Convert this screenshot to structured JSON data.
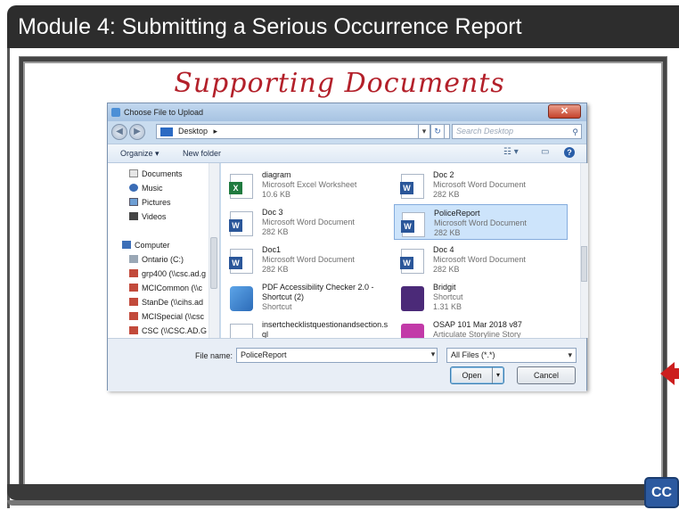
{
  "title_bar": {
    "text": "Module 4:  Submitting a Serious Occurrence Report"
  },
  "heading": {
    "text": "Supporting Documents"
  },
  "cc_button": {
    "label": "CC"
  },
  "dialog": {
    "title": "Choose File to Upload",
    "close_glyph": "✕",
    "address": {
      "location": "Desktop",
      "separator": "▸",
      "search_placeholder": "Search Desktop"
    },
    "toolbar": {
      "organize": "Organize ▾",
      "new_folder": "New folder"
    },
    "nav": [
      {
        "label": "Documents",
        "icon": "documents-icon"
      },
      {
        "label": "Music",
        "icon": "music-icon"
      },
      {
        "label": "Pictures",
        "icon": "pictures-icon"
      },
      {
        "label": "Videos",
        "icon": "videos-icon"
      },
      {
        "label": "Computer",
        "icon": "computer-icon"
      },
      {
        "label": "Ontario (C:)",
        "icon": "drive-icon"
      },
      {
        "label": "grp400 (\\\\csc.ad.g",
        "icon": "network-drive-icon"
      },
      {
        "label": "MCICommon (\\\\c",
        "icon": "network-drive-icon"
      },
      {
        "label": "StanDe (\\\\cihs.ad",
        "icon": "network-drive-icon"
      },
      {
        "label": "MCISpecial (\\\\csc",
        "icon": "network-drive-icon"
      },
      {
        "label": "CSC (\\\\CSC.AD.G",
        "icon": "network-drive-icon"
      }
    ],
    "files": [
      {
        "name": "diagram",
        "type": "Microsoft Excel Worksheet",
        "size": "10.6 KB",
        "icon": "excel-icon"
      },
      {
        "name": "Doc 2",
        "type": "Microsoft Word Document",
        "size": "282 KB",
        "icon": "word-icon"
      },
      {
        "name": "Doc 3",
        "type": "Microsoft Word Document",
        "size": "282 KB",
        "icon": "word-icon"
      },
      {
        "name": "PoliceReport",
        "type": "Microsoft Word Document",
        "size": "282 KB",
        "icon": "word-icon",
        "selected": true
      },
      {
        "name": "Doc1",
        "type": "Microsoft Word Document",
        "size": "282 KB",
        "icon": "word-icon"
      },
      {
        "name": "Doc 4",
        "type": "Microsoft Word Document",
        "size": "282 KB",
        "icon": "word-icon"
      },
      {
        "name": "PDF Accessibility Checker 2.0 -",
        "type": "Shortcut (2)",
        "size": "Shortcut",
        "icon": "pdf-checker-icon"
      },
      {
        "name": "Bridgit",
        "type": "Shortcut",
        "size": "1.31 KB",
        "icon": "bridgit-icon"
      },
      {
        "name": "insertchecklistquestionandsection.s",
        "type": "ql",
        "size": "",
        "icon": "sql-file-icon"
      },
      {
        "name": "OSAP 101 Mar 2018 v87",
        "type": "Articulate Storyline Story",
        "size": "",
        "icon": "storyline-icon"
      }
    ],
    "file_name_label": "File name:",
    "file_name_value": "PoliceReport",
    "file_type_value": "All Files (*.*)",
    "open_label": "Open",
    "cancel_label": "Cancel"
  },
  "colors": {
    "title_bg": "#2d2d2d",
    "heading": "#b3202a",
    "arrow": "#cc1e1e",
    "cc_bg": "#2c5aa0"
  }
}
